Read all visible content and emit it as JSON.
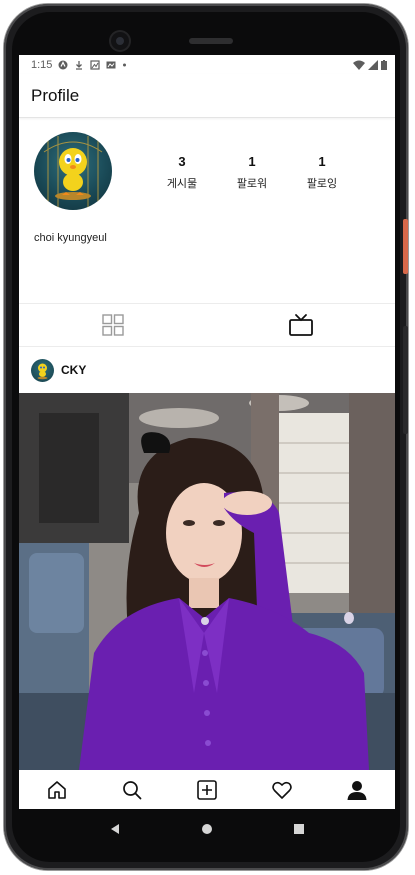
{
  "statusbar": {
    "time": "1:15",
    "icons": [
      "autorenew-icon",
      "download-icon",
      "image-icon",
      "photo-icon",
      "dot-icon"
    ],
    "right_icons": [
      "wifi-icon",
      "signal-icon",
      "battery-icon"
    ]
  },
  "appbar": {
    "title": "Profile"
  },
  "profile": {
    "name": "choi kyungyeul",
    "avatar_icon": "tweety-avatar",
    "stats": [
      {
        "value": "3",
        "label": "게시물"
      },
      {
        "value": "1",
        "label": "팔로워"
      },
      {
        "value": "1",
        "label": "팔로잉"
      }
    ]
  },
  "tabs": [
    {
      "icon": "grid-icon",
      "selected": false
    },
    {
      "icon": "tv-icon",
      "selected": true
    }
  ],
  "post": {
    "username": "CKY",
    "image_icon": "post-photo"
  },
  "bottom_nav": [
    "home-icon",
    "search-icon",
    "add-post-icon",
    "heart-icon",
    "profile-icon"
  ],
  "system_nav": [
    "back-icon",
    "home-circle-icon",
    "recents-icon"
  ],
  "colors": {
    "accent": "#111111",
    "purple_shirt": "#6a1fb0",
    "avatar_bg": "#1a4a57",
    "tweety_yellow": "#f3d21c"
  }
}
